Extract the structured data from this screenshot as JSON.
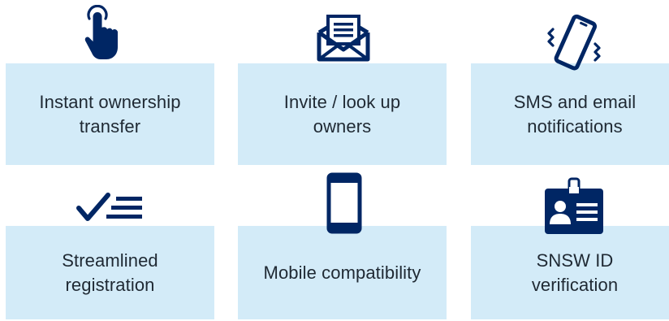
{
  "brand": {
    "icon_color": "#002664",
    "tile_color": "#d3ebf8",
    "text_color": "#1f2933"
  },
  "features": [
    {
      "label": "Instant ownership\ntransfer",
      "icon": "hand-pointer-icon"
    },
    {
      "label": "Invite / look up\nowners",
      "icon": "envelope-letter-icon"
    },
    {
      "label": "SMS and email\nnotifications",
      "icon": "vibrating-phone-icon"
    },
    {
      "label": "Streamlined\nregistration",
      "icon": "checklist-icon"
    },
    {
      "label": "Mobile compatibility",
      "icon": "mobile-phone-icon"
    },
    {
      "label": "SNSW ID\nverification",
      "icon": "id-card-icon"
    }
  ]
}
